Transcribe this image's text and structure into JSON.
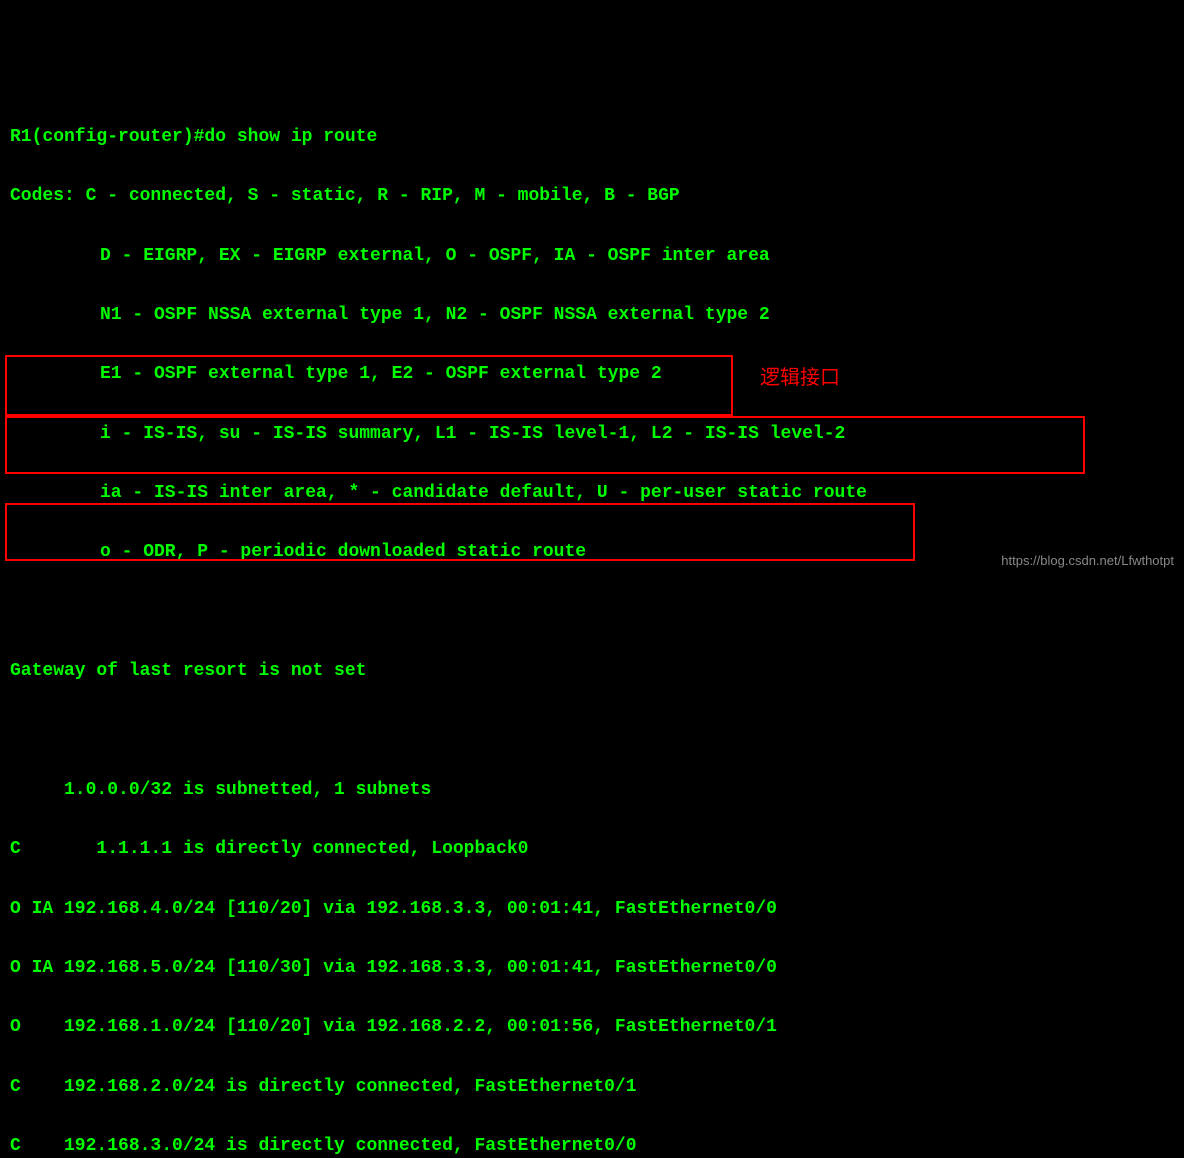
{
  "terminal": {
    "prompt": "R1(config-router)#do show ip route",
    "codes": [
      "Codes: C - connected, S - static, R - RIP, M - mobile, B - BGP",
      "D - EIGRP, EX - EIGRP external, O - OSPF, IA - OSPF inter area",
      "N1 - OSPF NSSA external type 1, N2 - OSPF NSSA external type 2",
      "E1 - OSPF external type 1, E2 - OSPF external type 2",
      "i - IS-IS, su - IS-IS summary, L1 - IS-IS level-1, L2 - IS-IS level-2",
      "ia - IS-IS inter area, * - candidate default, U - per-user static route",
      "o - ODR, P - periodic downloaded static route"
    ],
    "gateway": "Gateway of last resort is not set",
    "routes": [
      "     1.0.0.0/32 is subnetted, 1 subnets",
      "C       1.1.1.1 is directly connected, Loopback0",
      "O IA 192.168.4.0/24 [110/20] via 192.168.3.3, 00:01:41, FastEthernet0/0",
      "O IA 192.168.5.0/24 [110/30] via 192.168.3.3, 00:01:41, FastEthernet0/0",
      "O    192.168.1.0/24 [110/20] via 192.168.2.2, 00:01:56, FastEthernet0/1",
      "C    192.168.2.0/24 is directly connected, FastEthernet0/1",
      "C    192.168.3.0/24 is directly connected, FastEthernet0/0"
    ]
  },
  "annotations": {
    "label1": "逻辑接口"
  },
  "watermark": "https://blog.csdn.net/Lfwthotpt"
}
